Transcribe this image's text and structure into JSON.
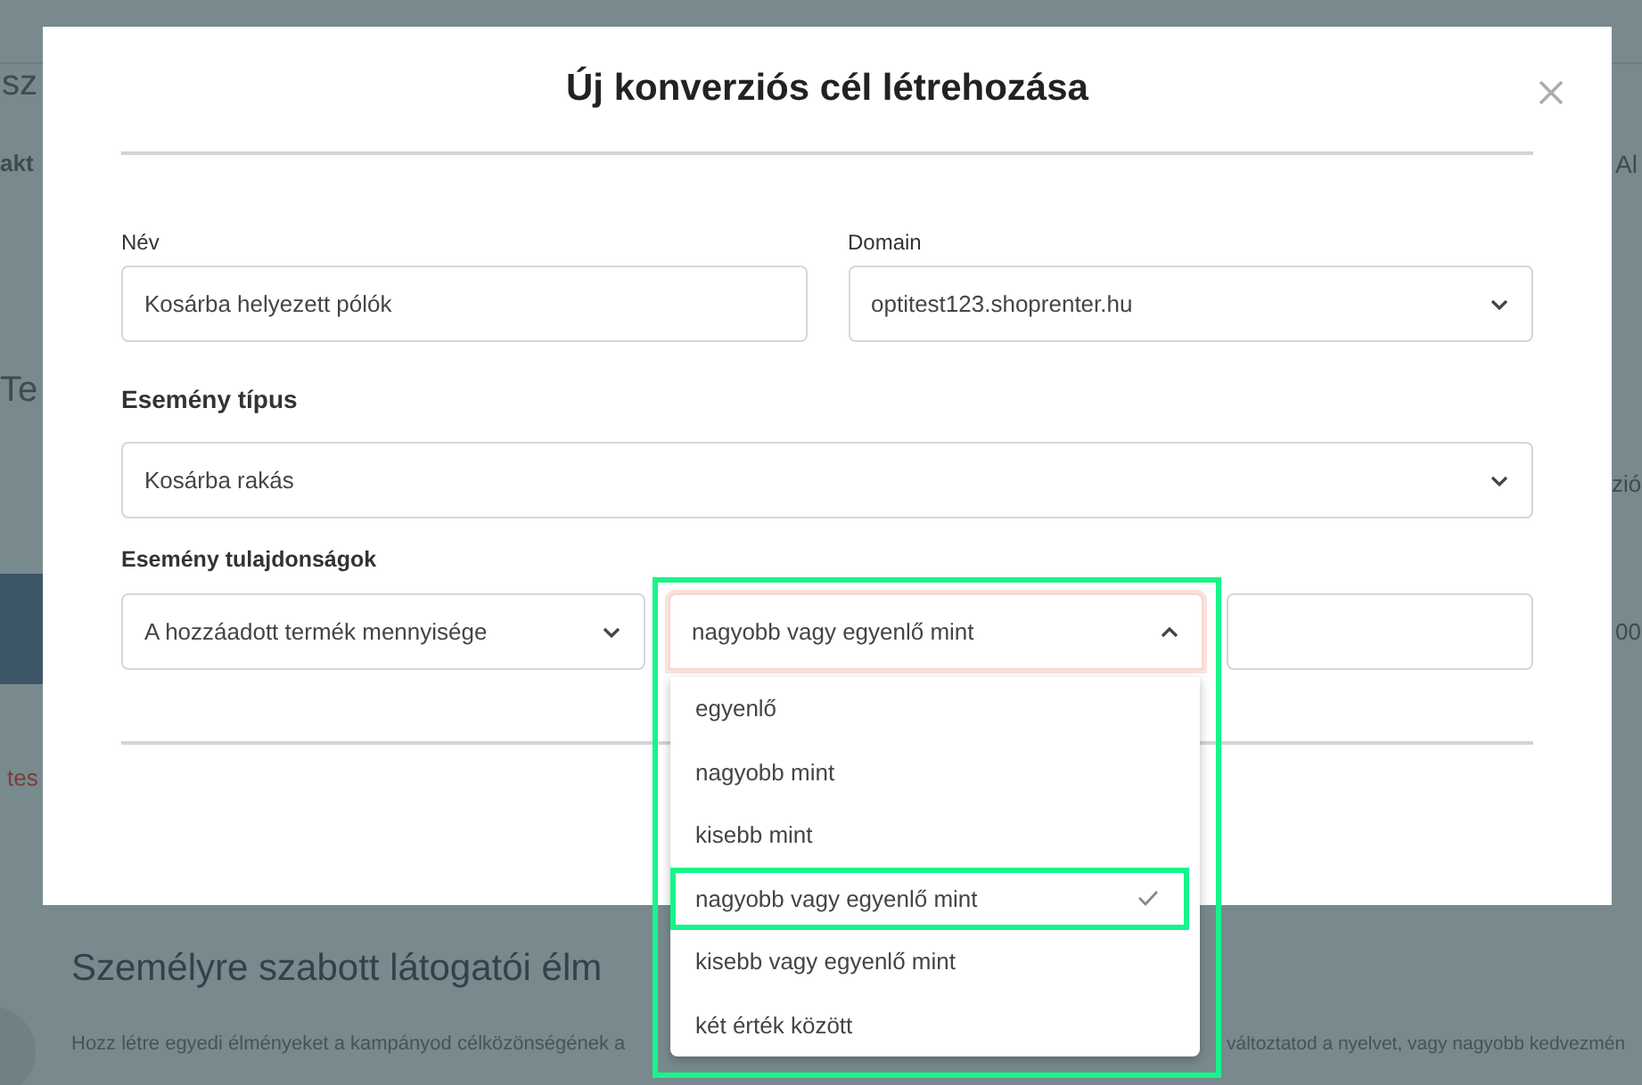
{
  "background": {
    "page_title": "sz",
    "tab_label": "akt",
    "section_title": "Te",
    "link_text": "tes",
    "column_header": "Al",
    "cell_text": "zió",
    "cell_number": "00",
    "heading": "Személyre szabott látogatói élm",
    "description": "Hozz létre egyedi élményeket a kampányod célközönségének a",
    "description_end": "változtatod a nyelvet, vagy nagyobb kedvezmén"
  },
  "dialog": {
    "title": "Új konverziós cél létrehozása",
    "name_field": {
      "label": "Név",
      "value": "Kosárba helyezett pólók"
    },
    "domain_field": {
      "label": "Domain",
      "value": "optitest123.shoprenter.hu"
    },
    "event_type": {
      "label": "Esemény típus",
      "value": "Kosárba rakás"
    },
    "event_properties": {
      "label": "Esemény tulajdonságok",
      "property": {
        "value": "A hozzáadott termék mennyisége",
        "expanded": false
      },
      "operator": {
        "value": "nagyobb vagy egyenlő mint",
        "expanded": true
      }
    },
    "operator_options": [
      {
        "label": "egyenlő",
        "selected": false
      },
      {
        "label": "nagyobb mint",
        "selected": false
      },
      {
        "label": "kisebb mint",
        "selected": false
      },
      {
        "label": "nagyobb vagy egyenlő mint",
        "selected": true
      },
      {
        "label": "kisebb vagy egyenlő mint",
        "selected": false
      },
      {
        "label": "két érték között",
        "selected": false
      }
    ]
  }
}
